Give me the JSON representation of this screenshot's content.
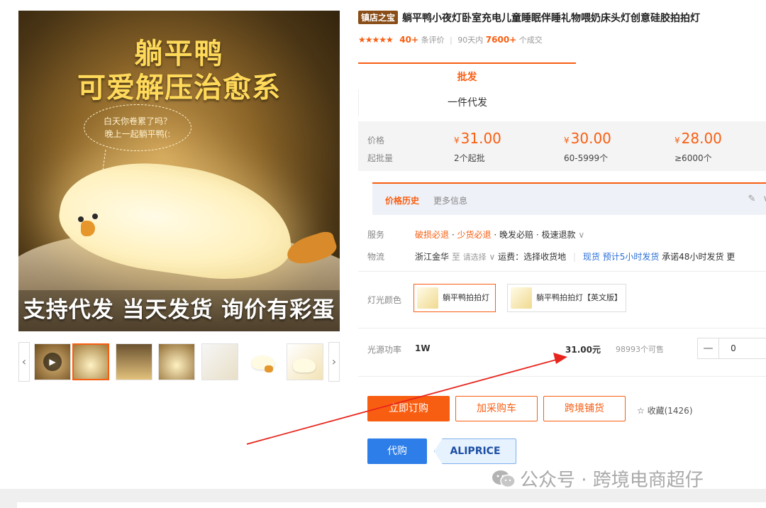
{
  "gallery": {
    "main_title_line1": "躺平鸭",
    "main_title_line2": "可爱解压治愈系",
    "bubble_line1": "白天你卷累了吗？",
    "bubble_line2": "晚上一起躺平鸭(:",
    "banner": "支持代发 当天发货 询价有彩蛋",
    "prev_arrow": "‹",
    "next_arrow": "›",
    "play_glyph": "▶"
  },
  "product": {
    "badge": "镇店之宝",
    "title": "躺平鸭小夜灯卧室充电儿童睡眠伴睡礼物喂奶床头灯创意硅胶拍拍灯",
    "stars": "★★★★★",
    "review_count": "40+",
    "review_label": "条评价",
    "sales_period": "90天内",
    "sales_count": "7600+",
    "sales_label": "个成交"
  },
  "mode_tabs": [
    {
      "label": "批发",
      "active": true
    },
    {
      "label": "一件代发",
      "active": false
    }
  ],
  "price_box": {
    "price_label": "价格",
    "moq_label": "起批量",
    "currency": "¥",
    "tiers": [
      {
        "price": "31.00",
        "range": "2个起批"
      },
      {
        "price": "30.00",
        "range": "60-5999个"
      },
      {
        "price": "28.00",
        "range": "≥6000个"
      }
    ]
  },
  "history": {
    "tab_active": "价格历史",
    "tab_more": "更多信息",
    "edit_icon": "✎",
    "collapse_icon": "∨"
  },
  "service": {
    "label": "服务",
    "item1": "破损必退",
    "item2": "少货必退",
    "item3": "晚发必赔",
    "item4": "极速退款",
    "dot": "·",
    "more": "∨"
  },
  "logistics": {
    "label": "物流",
    "from": "浙江金华",
    "to_word": "至",
    "to_select": "请选择",
    "to_arrow": "∨",
    "freight": "运费：选择收货地",
    "stock_type": "现货",
    "eta": "预计5小时发货",
    "promise": "承诺48小时发货",
    "more": "更"
  },
  "sku": {
    "label": "灯光颜色",
    "options": [
      {
        "label": "躺平鸭拍拍灯",
        "selected": true
      },
      {
        "label": "躺平鸭拍拍灯【英文版】",
        "selected": false
      }
    ]
  },
  "spec": {
    "label": "光源功率",
    "name": "1W",
    "price": "31.00元",
    "stock": "98993个可售",
    "minus": "—",
    "quantity": "0"
  },
  "actions": {
    "order": "立即订购",
    "cart": "加采购车",
    "cross_border": "跨境铺货",
    "favorite_icon": "☆",
    "favorite": "收藏(1426)",
    "proxy": "代购",
    "aliprice": "ALIPRICE"
  },
  "watermark": {
    "text": "公众号 · 跨境电商超仔"
  },
  "colors": {
    "accent": "#f85e12",
    "link_blue": "#2b6fd8",
    "annotation_arrow": "#e8251c"
  }
}
